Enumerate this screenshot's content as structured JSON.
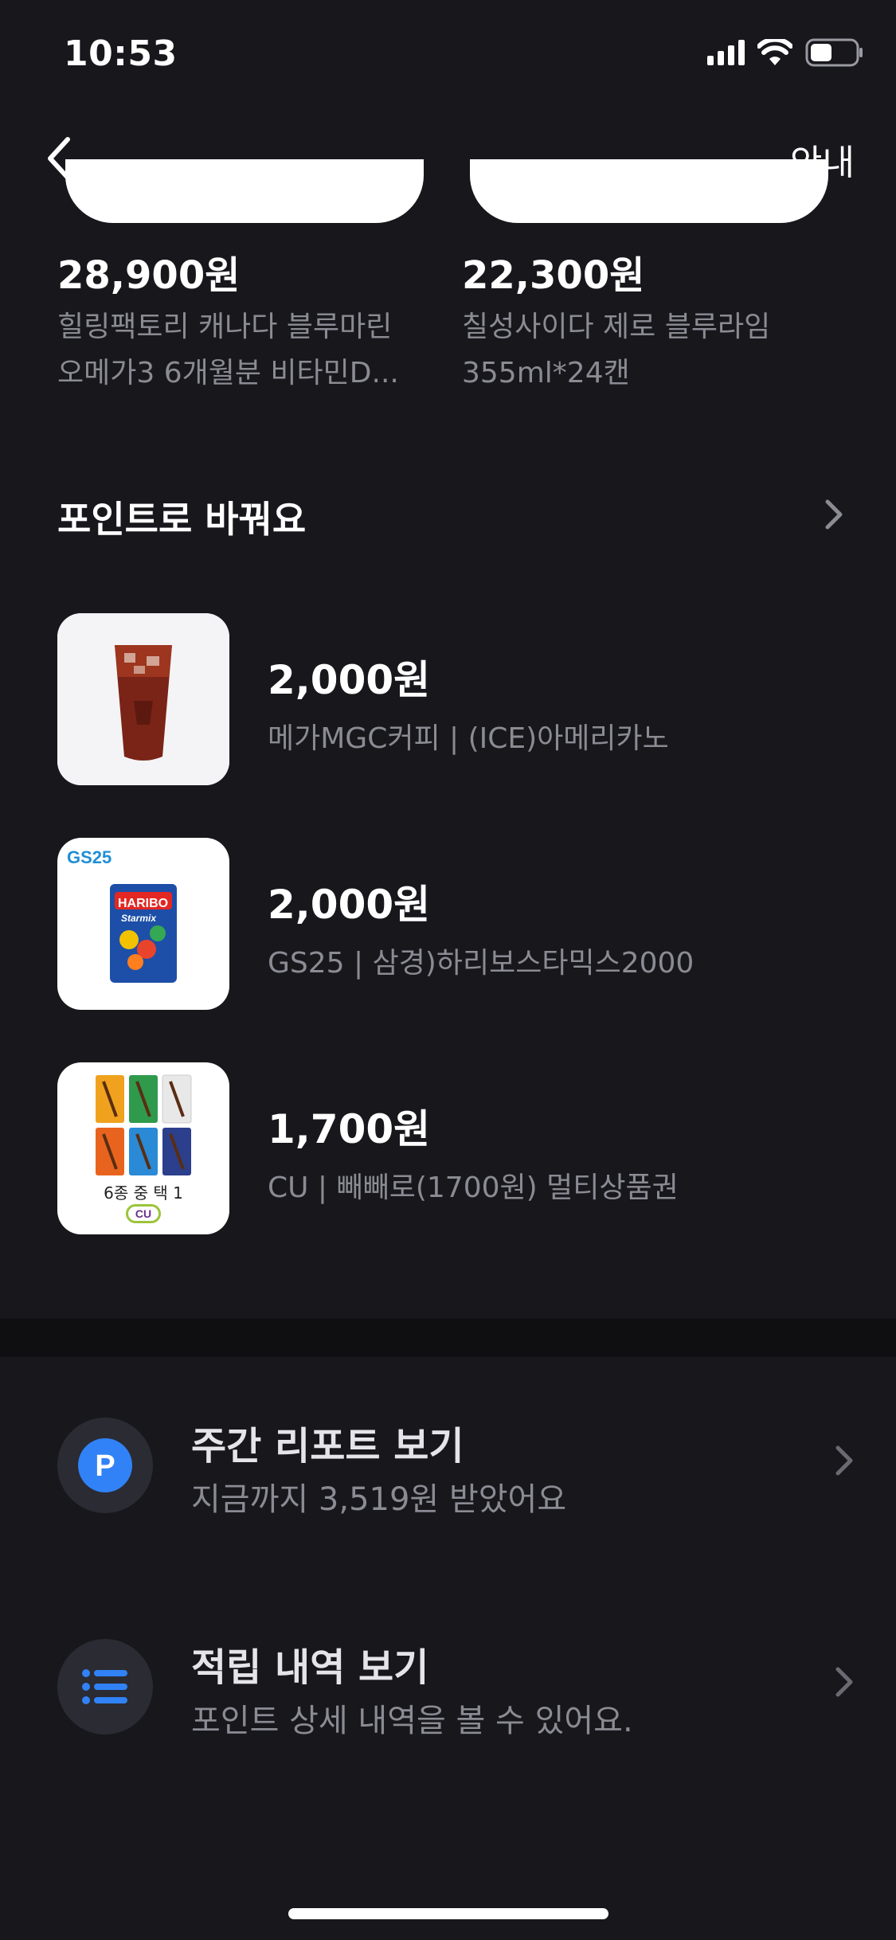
{
  "status_bar": {
    "time": "10:53"
  },
  "nav": {
    "info_label": "안내"
  },
  "top_products": [
    {
      "price": "28,900원",
      "name_line1": "힐링팩토리 캐나다 블루마린",
      "name_line2": "오메가3 6개월분 비타민D..."
    },
    {
      "price": "22,300원",
      "name_line1": "칠성사이다 제로 블루라임",
      "name_line2": "355ml*24캔"
    }
  ],
  "points_section": {
    "title": "포인트로 바꿔요",
    "items": [
      {
        "price": "2,000원",
        "name": "메가MGC커피 | (ICE)아메리카노"
      },
      {
        "price": "2,000원",
        "name": "GS25 | 삼경)하리보스타믹스2000",
        "thumb_badge": "GS25",
        "thumb_brand": "HARIBO",
        "thumb_sub": "Starmix"
      },
      {
        "price": "1,700원",
        "name": "CU | 빼빼로(1700원) 멀티상품권",
        "thumb_caption": "6종 중 택 1",
        "thumb_badge": "CU"
      }
    ]
  },
  "menu": [
    {
      "title": "주간 리포트 보기",
      "subtitle": "지금까지 3,519원 받았어요",
      "icon_letter": "P"
    },
    {
      "title": "적립 내역 보기",
      "subtitle": "포인트 상세 내역을 볼 수 있어요."
    }
  ],
  "colors": {
    "background": "#17171c",
    "accent": "#3182f6",
    "muted_text": "#8b8b94"
  }
}
